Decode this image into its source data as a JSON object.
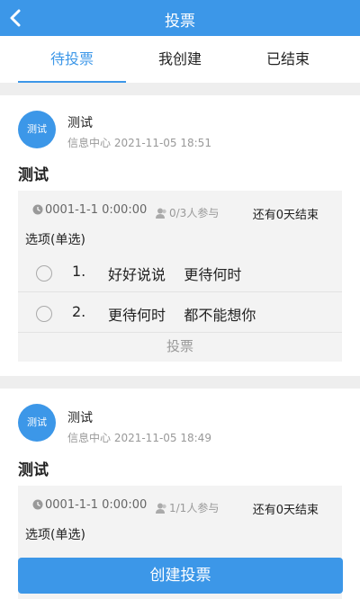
{
  "header": {
    "title": "投票",
    "back_icon": "chevron-left-icon"
  },
  "tabs": [
    {
      "label": "待投票",
      "active": true
    },
    {
      "label": "我创建",
      "active": false
    },
    {
      "label": "已结束",
      "active": false
    }
  ],
  "accent_color": "#3c97e8",
  "votes": [
    {
      "avatar_text": "测试",
      "author": "测试",
      "meta": "信息中心 2021-11-05 18:51",
      "title": "测试",
      "time": "0001-1-1 0:00:00",
      "participants": "0/3人参与",
      "remaining": "还有0天结束",
      "option_type": "选项(单选)",
      "options": [
        {
          "num": "1.",
          "text": "好好说说    更待何时"
        },
        {
          "num": "2.",
          "text": "更待何时    都不能想你"
        }
      ],
      "vote_label": "投票"
    },
    {
      "avatar_text": "测试",
      "author": "测试",
      "meta": "信息中心 2021-11-05 18:49",
      "title": "测试",
      "time": "0001-1-1 0:00:00",
      "participants": "1/1人参与",
      "remaining": "还有0天结束",
      "option_type": "选项(单选)"
    }
  ],
  "create_button": "创建投票"
}
